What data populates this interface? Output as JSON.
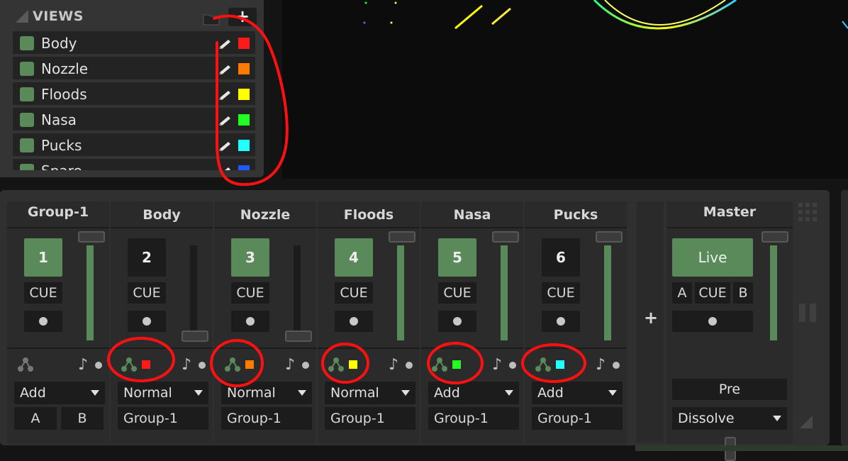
{
  "views": {
    "title": "VIEWS",
    "add_label": "+",
    "items": [
      {
        "label": "Body",
        "color": "#ff1a1a"
      },
      {
        "label": "Nozzle",
        "color": "#ff7a00"
      },
      {
        "label": "Floods",
        "color": "#ffff00"
      },
      {
        "label": "Nasa",
        "color": "#22ff22"
      },
      {
        "label": "Pucks",
        "color": "#22ffff"
      },
      {
        "label": "Spare",
        "color": "#1a5cff"
      }
    ]
  },
  "mixer": {
    "group": {
      "title": "Group-1",
      "number": "1",
      "cue": "CUE",
      "blend": "Add",
      "a": "A",
      "b": "B",
      "active": true,
      "level": 1.0
    },
    "channels": [
      {
        "title": "Body",
        "number": "2",
        "cue": "CUE",
        "blend": "Normal",
        "group": "Group-1",
        "active": false,
        "color": "#ff1a1a",
        "level": 0.0
      },
      {
        "title": "Nozzle",
        "number": "3",
        "cue": "CUE",
        "blend": "Normal",
        "group": "Group-1",
        "active": true,
        "color": "#ff7a00",
        "level": 0.0
      },
      {
        "title": "Floods",
        "number": "4",
        "cue": "CUE",
        "blend": "Normal",
        "group": "Group-1",
        "active": true,
        "color": "#ffff00",
        "level": 1.0
      },
      {
        "title": "Nasa",
        "number": "5",
        "cue": "CUE",
        "blend": "Add",
        "group": "Group-1",
        "active": true,
        "color": "#22ff22",
        "level": 1.0
      },
      {
        "title": "Pucks",
        "number": "6",
        "cue": "CUE",
        "blend": "Add",
        "group": "Group-1",
        "active": false,
        "color": "#22ffff",
        "level": 1.0
      }
    ],
    "add_channel": "+",
    "master": {
      "title": "Master",
      "live": "Live",
      "a": "A",
      "cue": "CUE",
      "b": "B",
      "pre": "Pre",
      "transition": "Dissolve",
      "level": 1.0,
      "crossfade": 0.5
    }
  },
  "accent": "#5b8a5a"
}
